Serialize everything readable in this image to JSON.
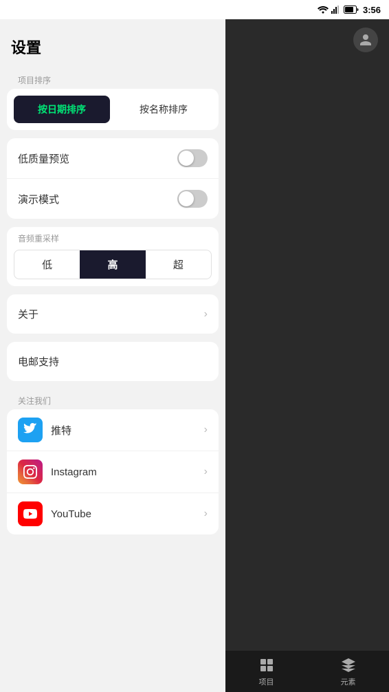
{
  "statusBar": {
    "time": "3:56"
  },
  "settings": {
    "title": "设置",
    "sortSection": {
      "label": "项目排序",
      "byDateLabel": "按日期排序",
      "byNameLabel": "按名称排序",
      "activeSort": "date"
    },
    "toggleSection": {
      "lowQualityLabel": "低质量预览",
      "lowQualityEnabled": false,
      "demoModeLabel": "演示模式",
      "demoModeEnabled": false
    },
    "audioSection": {
      "label": "音频重采样",
      "options": [
        "低",
        "高",
        "超"
      ],
      "activeOption": "高"
    },
    "aboutSection": {
      "label": "关于"
    },
    "emailSection": {
      "label": "电邮支持"
    },
    "followSection": {
      "label": "关注我们",
      "items": [
        {
          "platform": "twitter",
          "label": "推特"
        },
        {
          "platform": "instagram",
          "label": "Instagram"
        },
        {
          "platform": "youtube",
          "label": "YouTube"
        }
      ]
    }
  },
  "rightPanel": {
    "bottomNav": [
      {
        "label": "项目",
        "icon": "projects-icon"
      },
      {
        "label": "元素",
        "icon": "elements-icon"
      }
    ]
  }
}
